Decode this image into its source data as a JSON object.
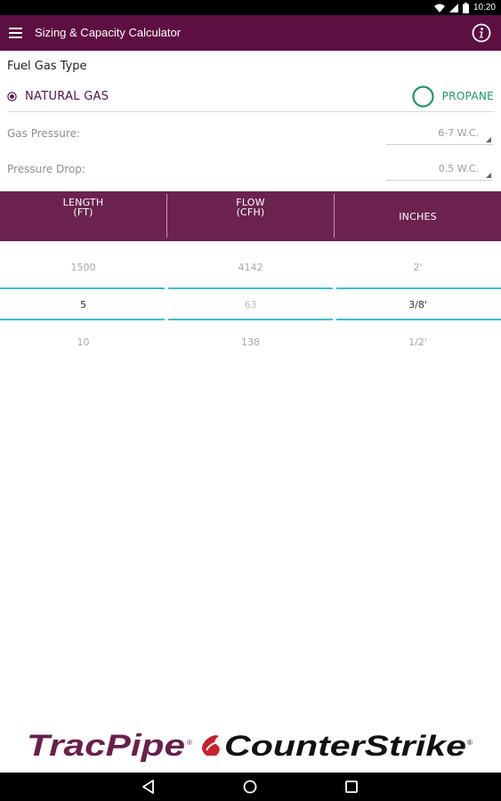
{
  "status_bar": {
    "time": "10:20"
  },
  "app_bar": {
    "title": "Sizing & Capacity Calculator"
  },
  "fuel": {
    "section_label": "Fuel Gas Type",
    "natural_label": "NATURAL GAS",
    "propane_label": "PROPANE",
    "selected": "NATURAL GAS"
  },
  "gas_pressure": {
    "label": "Gas Pressure:",
    "value": "6-7 W.C."
  },
  "pressure_drop": {
    "label": "Pressure Drop:",
    "value": "0.5 W.C."
  },
  "table": {
    "headers": [
      {
        "line1": "LENGTH",
        "line2": "(FT)"
      },
      {
        "line1": "FLOW",
        "line2": "(CFH)"
      },
      {
        "line1": "INCHES",
        "line2": ""
      }
    ],
    "rows": [
      [
        "1500",
        "4142",
        "2'"
      ],
      [
        "5",
        "63",
        "3/8'"
      ],
      [
        "10",
        "138",
        "1/2'"
      ]
    ],
    "selected_row": 1
  },
  "logo": {
    "left_brand": "TracPipe",
    "right_brand": "CounterStrike"
  },
  "colors": {
    "brand": "#5e0f42",
    "header": "#6b2250",
    "propane": "#1a9a5a",
    "selection_line": "#3bbfd6"
  },
  "icons": [
    "wifi-icon",
    "signal-icon",
    "battery-icon",
    "hamburger-menu-icon",
    "info-icon",
    "radio-selected-icon",
    "radio-unselected-icon",
    "dropdown-arrow-icon",
    "flame-icon",
    "back-icon",
    "home-icon",
    "recents-icon"
  ]
}
